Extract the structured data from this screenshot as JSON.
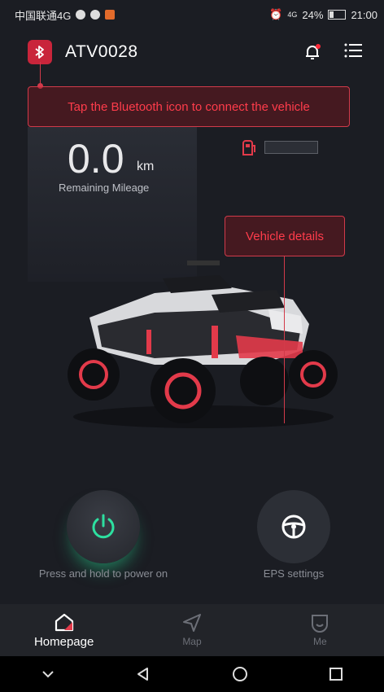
{
  "status_bar": {
    "carrier": "中国联通4G",
    "signal": "4G",
    "battery": "24%",
    "time": "21:00"
  },
  "header": {
    "title": "ATV0028",
    "icons": [
      "bluetooth-icon",
      "bell-icon",
      "menu-icon"
    ]
  },
  "bluetooth_tip": "Tap the Bluetooth icon to connect the vehicle",
  "mileage": {
    "value": "0.0",
    "unit": "km",
    "label": "Remaining Mileage"
  },
  "fuel": {
    "icon": "fuel-icon",
    "level": 0
  },
  "vehicle_details_tag": "Vehicle details",
  "controls": {
    "power_label": "Press and hold to power on",
    "eps_label": "EPS settings"
  },
  "tabs": [
    {
      "label": "Homepage",
      "icon": "home-icon",
      "active": true
    },
    {
      "label": "Map",
      "icon": "navigation-icon",
      "active": false
    },
    {
      "label": "Me",
      "icon": "profile-icon",
      "active": false
    }
  ],
  "colors": {
    "accent": "#c9253b",
    "tip_text": "#ff3c4b",
    "power_glow": "#28dc96"
  }
}
